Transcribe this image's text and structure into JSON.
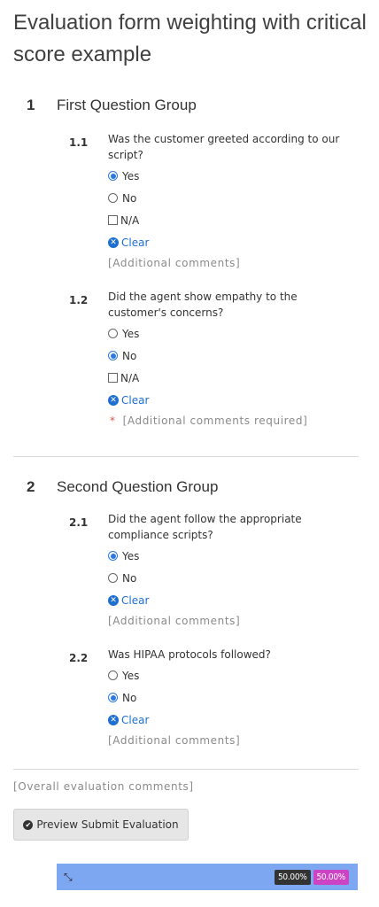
{
  "title": "Evaluation form weighting with critical score example",
  "groups": [
    {
      "number": "1",
      "title": "First Question Group",
      "questions": [
        {
          "number": "1.1",
          "text": "Was the customer greeted according to our script?",
          "options": [
            {
              "label": "Yes",
              "type": "radio",
              "selected": true
            },
            {
              "label": "No",
              "type": "radio",
              "selected": false
            },
            {
              "label": "N/A",
              "type": "checkbox",
              "selected": false
            }
          ],
          "clear_label": "Clear",
          "comments": "[Additional comments]"
        },
        {
          "number": "1.2",
          "text": "Did the agent show empathy to the customer's concerns?",
          "options": [
            {
              "label": "Yes",
              "type": "radio",
              "selected": false
            },
            {
              "label": "No",
              "type": "radio",
              "selected": true
            },
            {
              "label": "N/A",
              "type": "checkbox",
              "selected": false
            }
          ],
          "clear_label": "Clear",
          "required_marker": "*",
          "comments": "[Additional comments required]"
        }
      ]
    },
    {
      "number": "2",
      "title": "Second Question Group",
      "questions": [
        {
          "number": "2.1",
          "text": "Did the agent follow the appropriate compliance scripts?",
          "options": [
            {
              "label": "Yes",
              "type": "radio",
              "selected": true
            },
            {
              "label": "No",
              "type": "radio",
              "selected": false
            }
          ],
          "clear_label": "Clear",
          "comments": "[Additional comments]"
        },
        {
          "number": "2.2",
          "text": "Was HIPAA protocols followed?",
          "options": [
            {
              "label": "Yes",
              "type": "radio",
              "selected": false
            },
            {
              "label": "No",
              "type": "radio",
              "selected": true
            }
          ],
          "clear_label": "Clear",
          "comments": "[Additional comments]"
        }
      ]
    }
  ],
  "overall_comments": "[Overall evaluation comments]",
  "preview_button": {
    "label": "Preview Submit Evaluation",
    "icon": "check-circle-icon"
  },
  "score_bar": {
    "collapse_icon": "collapse-arrows-icon",
    "score_1": "50.00%",
    "score_2": "50.00%",
    "colors": {
      "bar": "#7da7f0",
      "score_1": "#333333",
      "score_2": "#cc44c4"
    }
  },
  "colors": {
    "accent": "#2b78e4",
    "link": "#1f6fd1",
    "required": "#d9534f"
  }
}
